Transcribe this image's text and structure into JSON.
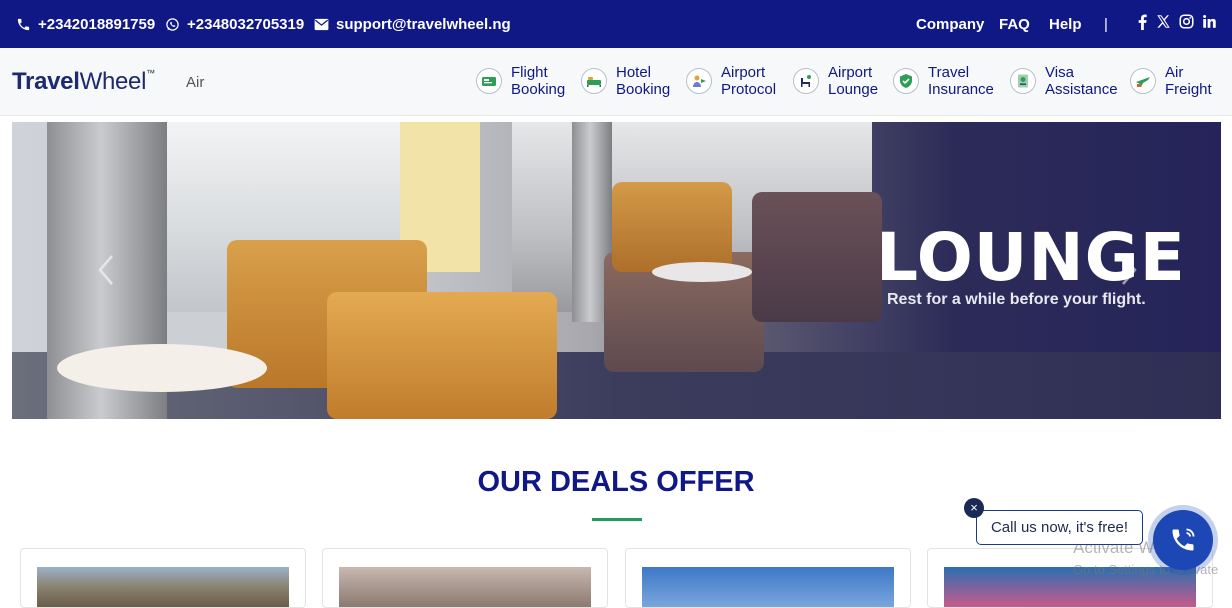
{
  "topbar": {
    "phone": "+2342018891759",
    "whatsapp": "+2348032705319",
    "email": "support@travelwheel.ng",
    "links": [
      "Company",
      "FAQ",
      "Help"
    ],
    "divider": "|",
    "social_icons": [
      "facebook-icon",
      "x-twitter-icon",
      "instagram-icon",
      "linkedin-icon"
    ]
  },
  "brand": {
    "name_bold": "Travel",
    "name_light": "Wheel",
    "tm": "™",
    "tag": "Air"
  },
  "nav": [
    {
      "line1": "Flight",
      "line2": "Booking",
      "icon": "flight-booking-icon"
    },
    {
      "line1": "Hotel",
      "line2": "Booking",
      "icon": "hotel-booking-icon"
    },
    {
      "line1": "Airport",
      "line2": "Protocol",
      "icon": "airport-protocol-icon"
    },
    {
      "line1": "Airport",
      "line2": "Lounge",
      "icon": "airport-lounge-icon"
    },
    {
      "line1": "Travel",
      "line2": "Insurance",
      "icon": "travel-insurance-icon"
    },
    {
      "line1": "Visa",
      "line2": "Assistance",
      "icon": "visa-assistance-icon"
    },
    {
      "line1": "Air",
      "line2": "Freight",
      "icon": "air-freight-icon"
    }
  ],
  "hero": {
    "title": "LOUNGE",
    "subtitle": "Rest for a while before your flight."
  },
  "deals": {
    "title": "OUR DEALS OFFER"
  },
  "call_widget": {
    "close": "×",
    "text": "Call us now, it's free!"
  },
  "os_watermark": {
    "line1": "Activate Windows",
    "line2": "Go to Settings to activate"
  },
  "colors": {
    "primary": "#0f1885",
    "accent_green": "#1f9d57",
    "call_blue": "#1d47b5"
  }
}
